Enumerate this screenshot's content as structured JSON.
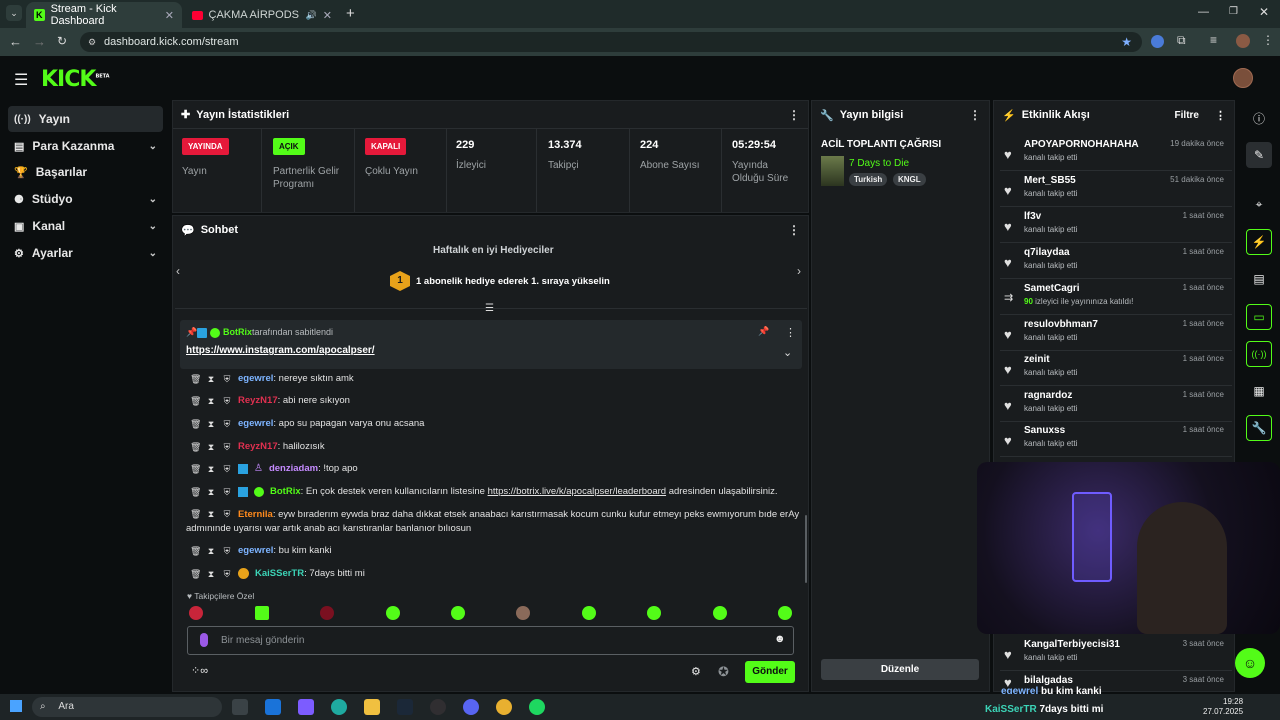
{
  "browser": {
    "tabs": [
      {
        "title": "Stream - Kick Dashboard",
        "active": true
      },
      {
        "title": "ÇAKMA AİRPODS! | #eray",
        "active": false
      }
    ],
    "url": "dashboard.kick.com/stream"
  },
  "app": {
    "logo": "KICK",
    "logo_sup": "BETA"
  },
  "nav": {
    "items": [
      {
        "label": "Yayın",
        "icon": "broadcast-icon",
        "active": true
      },
      {
        "label": "Para Kazanma",
        "icon": "money-icon",
        "expandable": true
      },
      {
        "label": "Başarılar",
        "icon": "trophy-icon"
      },
      {
        "label": "Stüdyo",
        "icon": "studio-icon",
        "expandable": true
      },
      {
        "label": "Kanal",
        "icon": "channel-icon",
        "expandable": true
      },
      {
        "label": "Ayarlar",
        "icon": "gear-icon",
        "expandable": true
      }
    ]
  },
  "stats_panel": {
    "title": "Yayın İstatistikleri",
    "cards": [
      {
        "badge": "YAYINDA",
        "badge_color": "#e5193a",
        "label": "Yayın"
      },
      {
        "badge": "AÇIK",
        "badge_color": "#53fc18",
        "label": "Partnerlik Gelir Programı"
      },
      {
        "badge": "KAPALI",
        "badge_color": "#e5193a",
        "label": "Çoklu Yayın"
      },
      {
        "value": "229",
        "label": "İzleyici"
      },
      {
        "value": "13.374",
        "label": "Takipçi"
      },
      {
        "value": "224",
        "label": "Abone Sayısı"
      },
      {
        "value": "05:29:54",
        "label": "Yayında Olduğu Süre"
      }
    ]
  },
  "stream_info": {
    "title": "Yayın bilgisi",
    "stream_title": "ACİL TOPLANTI ÇAĞRISI",
    "category": "7 Days to Die",
    "tags": [
      "Turkish",
      "KNGL"
    ],
    "edit_button": "Düzenle"
  },
  "chat": {
    "title": "Sohbet",
    "gifters_title": "Haftalık en iyi Hediyeciler",
    "gifters_rank": "1",
    "gifters_text": "1 abonelik hediye ederek 1. sıraya yükselin",
    "pinned": {
      "user": "BotRix",
      "by_text": "tarafından sabitlendi",
      "link": "https://www.instagram.com/apocalpser/"
    },
    "messages": [
      {
        "user": "egewrel",
        "color": "blue",
        "text": ": nereye sıktın amk"
      },
      {
        "user": "ReyzN17",
        "color": "red",
        "text": ": abi nere sıkıyon"
      },
      {
        "user": "egewrel",
        "color": "blue",
        "text": ": apo su papagan varya onu acsana"
      },
      {
        "user": "ReyzN17",
        "color": "red",
        "text": ": halilozısık"
      },
      {
        "user": "denziadam",
        "color": "purple",
        "text": ": !top apo"
      },
      {
        "user": "BotRix",
        "color": "green",
        "text": ": En çok destek veren kullanıcıların listesine ",
        "link": "https://botrix.live/k/apocalpser/leaderboard",
        "text2": " adresinden ulaşabilirsiniz."
      },
      {
        "user": "Eternila",
        "color": "orange",
        "text": ": eyw bıraderım eywda braz daha dıkkat etsek anaabacı karıstırmasak kocum cunku kufur etmeyı peks ewmıyorum bıde erAy",
        "text2": "admınınde uyarısı war artık anab acı karıstıranlar banlanıor bılıosun"
      },
      {
        "user": "egewrel",
        "color": "blue",
        "text": ": bu kim kanki"
      },
      {
        "user": "KaiSSerTR",
        "color": "teal",
        "text": ": 7days bitti mi"
      }
    ],
    "followers_only": "Takipçilere Özel",
    "input_placeholder": "Bir mesaj gönderin",
    "send_button": "Gönder"
  },
  "activity": {
    "title": "Etkinlik Akışı",
    "filter": "Filtre",
    "items": [
      {
        "name": "APOYAPORNOHAHAHA",
        "sub": "kanalı takip etti",
        "time": "19 dakika önce"
      },
      {
        "name": "Mert_SB55",
        "sub": "kanalı takip etti",
        "time": "51 dakika önce"
      },
      {
        "name": "lf3v",
        "sub": "kanalı takip etti",
        "time": "1 saat önce"
      },
      {
        "name": "q7ilaydaa",
        "sub": "kanalı takip etti",
        "time": "1 saat önce"
      },
      {
        "name": "SametCagri",
        "sub_num": "90",
        "sub": "izleyici ile yayınınıza katıldı!",
        "time": "1 saat önce",
        "raid": true
      },
      {
        "name": "resulovbhman7",
        "sub": "kanalı takip etti",
        "time": "1 saat önce"
      },
      {
        "name": "zeinit",
        "sub": "kanalı takip etti",
        "time": "1 saat önce"
      },
      {
        "name": "ragnardoz",
        "sub": "kanalı takip etti",
        "time": "1 saat önce"
      },
      {
        "name": "Sanuxss",
        "sub": "kanalı takip etti",
        "time": "1 saat önce"
      },
      {
        "name": "KangalTerbiyecisi31",
        "sub": "kanalı takip etti",
        "time": "3 saat önce"
      },
      {
        "name": "bilalgadas",
        "sub": "kanalı takip etti",
        "time": "3 saat önce"
      }
    ]
  },
  "overlay": {
    "line1_user": "egewrel",
    "line1_text": "bu kim kanki",
    "line2_user": "KaiSSerTR",
    "line2_text": "7days bitti mi"
  },
  "taskbar": {
    "search": "Ara",
    "time": "19:28",
    "date": "27.07.2025"
  }
}
